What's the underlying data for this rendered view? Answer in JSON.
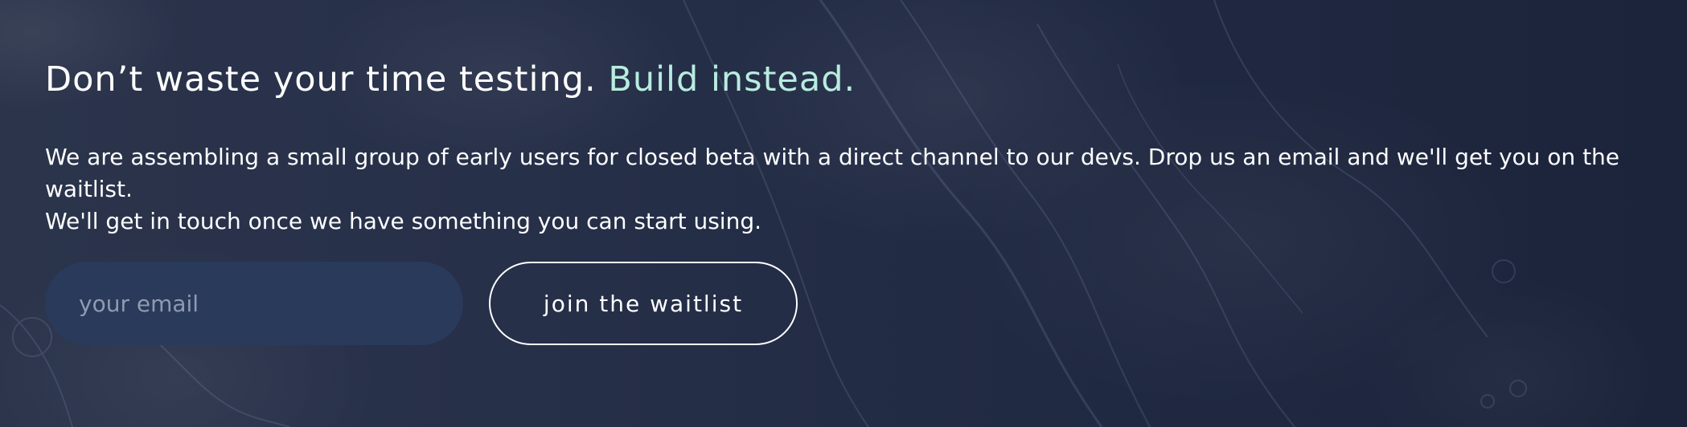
{
  "hero": {
    "headline_main": "Don’t waste your time testing.",
    "headline_accent": "Build instead.",
    "description_line1": "We are assembling a small group of early users for closed beta with a direct channel to our devs. Drop us an email and we'll get you on the waitlist.",
    "description_line2": "We'll get in touch once we have something you can start using."
  },
  "signup": {
    "email_placeholder": "your email",
    "email_value": "",
    "button_label": "join the waitlist"
  },
  "colors": {
    "background": "#232c44",
    "accent_text": "#b8ecdf",
    "input_background": "#293a5a",
    "button_border": "#ffffff"
  }
}
